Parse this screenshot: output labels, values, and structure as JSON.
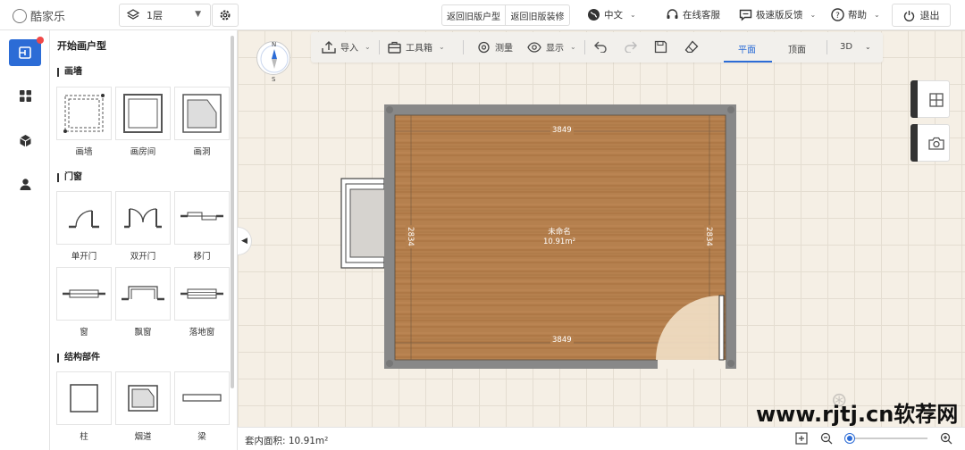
{
  "app": {
    "logo_text": "酷家乐"
  },
  "topbar": {
    "floor_select": "1层",
    "old_floorplan": "返回旧版户型",
    "old_decor": "返回旧版装修",
    "language": "中文",
    "online_service": "在线客服",
    "feedback": "极速版反馈",
    "help": "帮助",
    "logout": "退出"
  },
  "sidebar": {
    "items": [
      {
        "icon": "floorplan-icon",
        "active": true,
        "badge": true
      },
      {
        "icon": "grid-icon"
      },
      {
        "icon": "cube-icon"
      },
      {
        "icon": "user-icon"
      }
    ]
  },
  "panel": {
    "title": "开始画户型",
    "sections": [
      {
        "title": "画墙",
        "items": [
          "画墙",
          "画房间",
          "画洞"
        ]
      },
      {
        "title": "门窗",
        "items": [
          "单开门",
          "双开门",
          "移门",
          "窗",
          "飘窗",
          "落地窗"
        ]
      },
      {
        "title": "结构部件",
        "items": [
          "柱",
          "烟道",
          "梁"
        ]
      }
    ]
  },
  "toolbar": {
    "import": "导入",
    "toolbox": "工具箱",
    "measure": "测量",
    "display": "显示",
    "view_tabs": [
      "平面",
      "顶面",
      "3D"
    ]
  },
  "compass": {
    "north": "N",
    "south": "S"
  },
  "room": {
    "name": "未命名",
    "area": "10.91m²",
    "width_dim": "3849",
    "height_dim": "2834"
  },
  "bottombar": {
    "area_label": "套内面积: 10.91m²",
    "zoom_level": 0.0
  },
  "watermark": "www.rjtj.cn软荐网"
}
